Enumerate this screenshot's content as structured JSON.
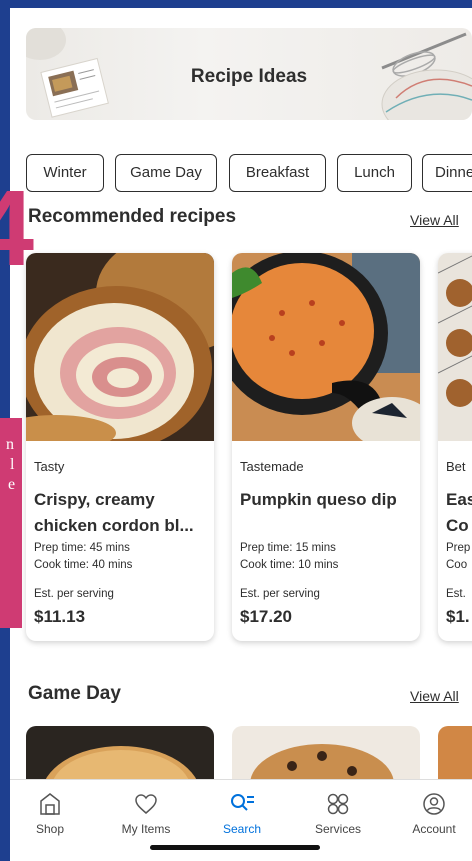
{
  "banner": {
    "title": "Recipe Ideas"
  },
  "chips": [
    "Winter",
    "Game Day",
    "Breakfast",
    "Lunch",
    "Dinner"
  ],
  "recommended": {
    "title": "Recommended recipes",
    "view_all": "View All",
    "cards": [
      {
        "source": "Tasty",
        "name": "Crispy, creamy chicken cordon bl...",
        "prep": "Prep time: 45 mins",
        "cook": "Cook time: 40 mins",
        "est_label": "Est. per serving",
        "price": "$11.13"
      },
      {
        "source": "Tastemade",
        "name": "Pumpkin queso dip",
        "prep": "Prep time: 15 mins",
        "cook": "Cook time: 10 mins",
        "est_label": "Est. per serving",
        "price": "$17.20"
      },
      {
        "source": "Bet",
        "name": "Eas Co",
        "prep": "Prep",
        "cook": "Coo",
        "est_label": "Est.",
        "price": "$1."
      }
    ]
  },
  "game_day": {
    "title": "Game Day",
    "view_all": "View All"
  },
  "nav": {
    "items": [
      {
        "label": "Shop",
        "icon": "store-icon"
      },
      {
        "label": "My Items",
        "icon": "heart-icon"
      },
      {
        "label": "Search",
        "icon": "search-icon",
        "active": true
      },
      {
        "label": "Services",
        "icon": "services-icon"
      },
      {
        "label": "Account",
        "icon": "account-icon"
      }
    ],
    "active_color": "#0071dc"
  },
  "overlay": {
    "glyph": "4",
    "lines": [
      "n",
      "l",
      "e"
    ],
    "color": "#cf3b73"
  },
  "colors": {
    "frame": "#1e3f8f",
    "text": "#2e2e2e"
  }
}
